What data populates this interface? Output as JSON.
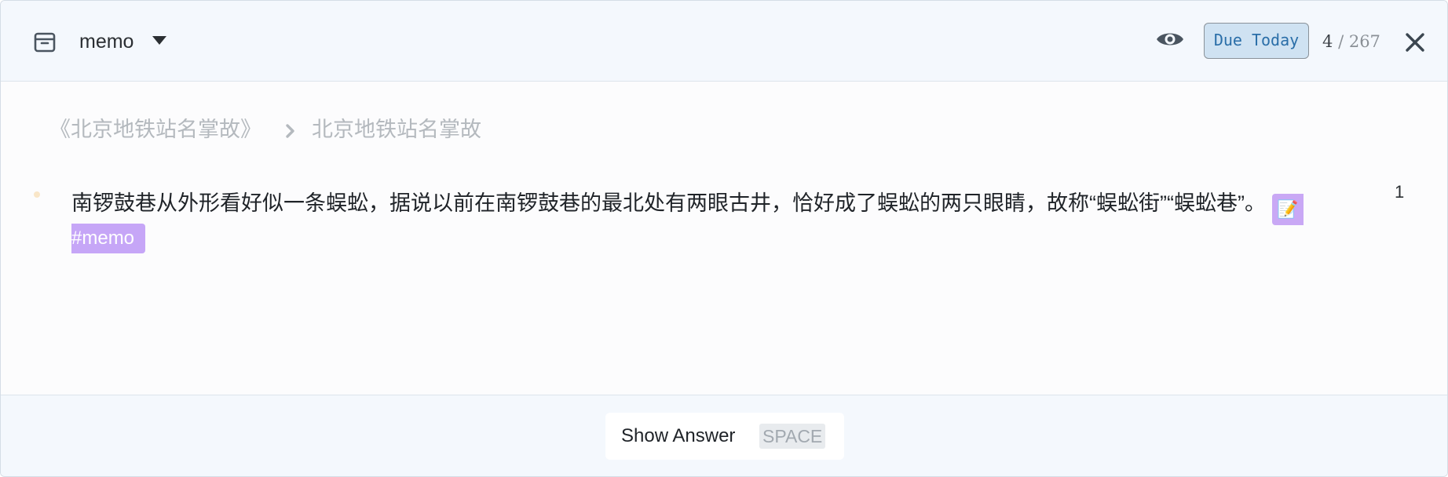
{
  "header": {
    "deck_name": "memo",
    "icons": {
      "deck": "archive-box-icon",
      "dropdown": "caret-down-icon",
      "preview": "eye-icon",
      "close": "close-icon"
    },
    "due_filter_label": "Due Today",
    "counter": {
      "current": "4",
      "separator": "/",
      "total": "267"
    }
  },
  "breadcrumb": {
    "page": "《北京地铁站名掌故》",
    "separator_icon": "chevron-right-icon",
    "block": "北京地铁站名掌故"
  },
  "card": {
    "text": "南锣鼓巷从外形看好似一条蜈蚣，据说以前在南锣鼓巷的最北处有两眼古井，恰好成了蜈蚣的两只眼睛，故称“蜈蚣街”“蜈蚣巷”。",
    "note_emoji": "📝",
    "tag": "#memo",
    "reference_count": "1"
  },
  "footer": {
    "show_answer_label": "Show Answer",
    "shortcut": "SPACE"
  },
  "colors": {
    "header_bg": "#f4f8fd",
    "due_button_bg": "#cfe2f2",
    "due_button_text": "#2a6ea8",
    "tag_bg": "#c6a6f7",
    "breadcrumb_text": "#b4b9be"
  }
}
